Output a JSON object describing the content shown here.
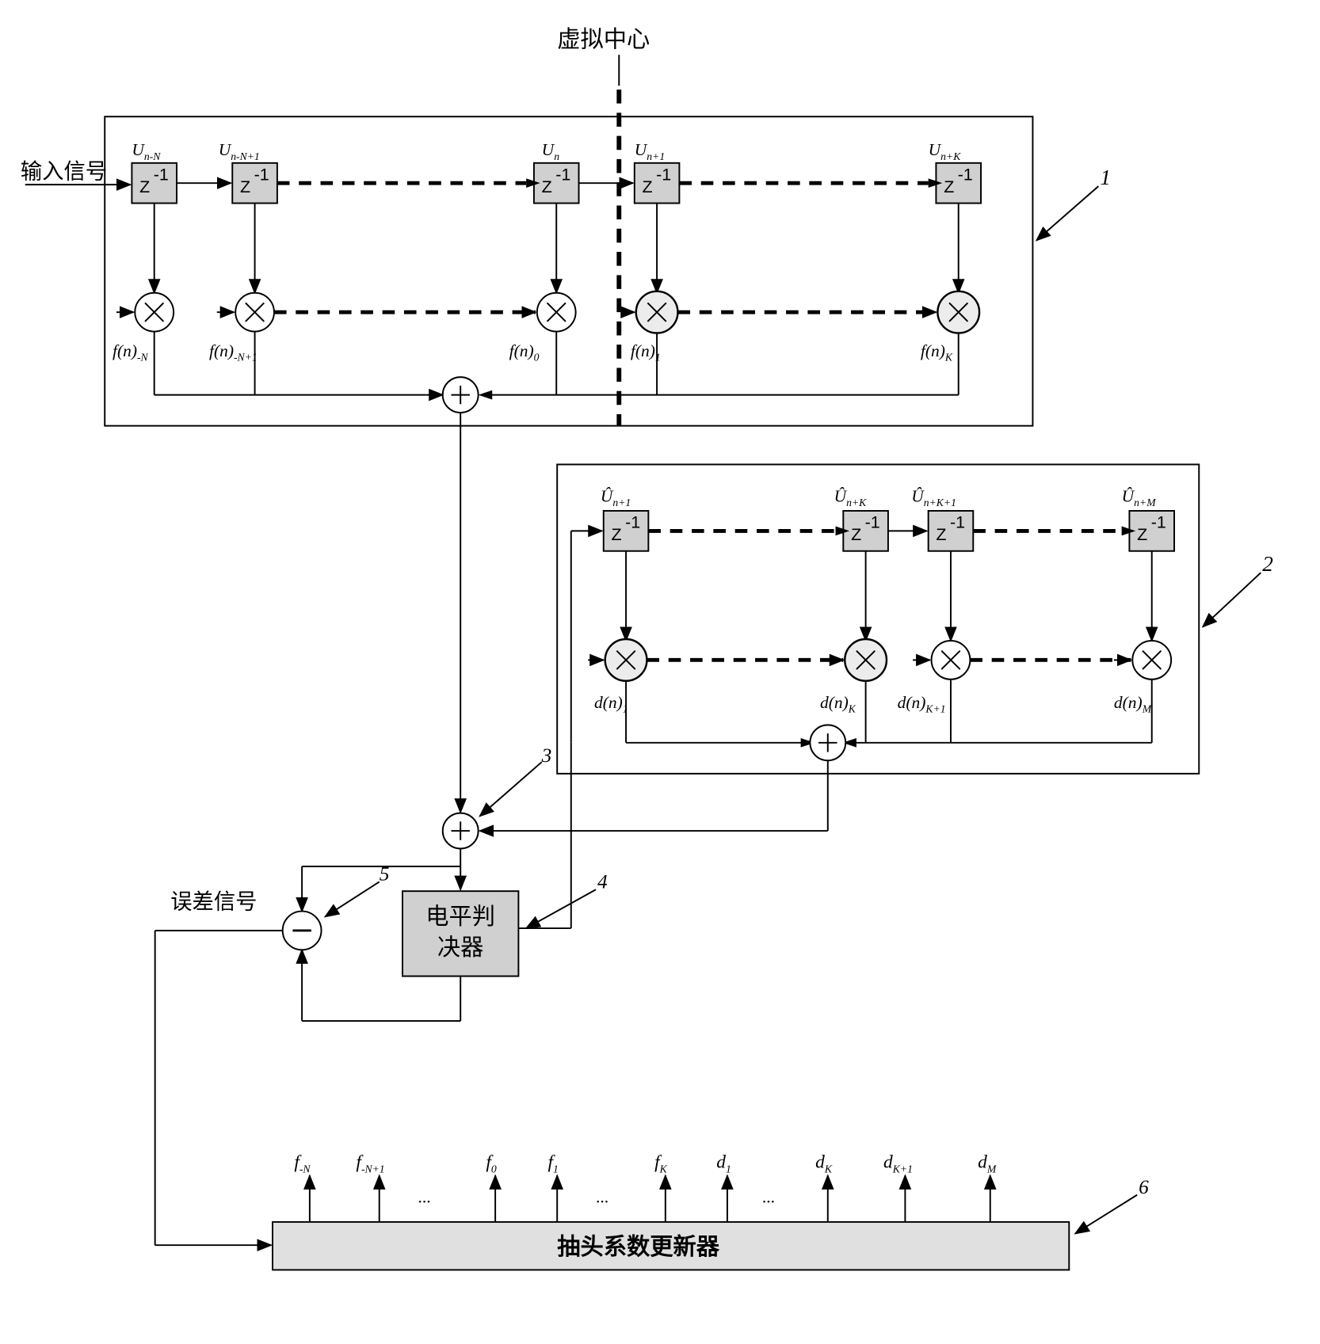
{
  "labels": {
    "virtualCenter": "虚拟中心",
    "inputSignal": "输入信号",
    "errorSignal": "误差信号",
    "levelDecider": "电平判决器",
    "tapUpdater": "抽头系数更新器",
    "zInv": "Z",
    "zExp": "-1"
  },
  "ff": {
    "delayLabels": [
      "U_{n-N}",
      "U_{n-N+1}",
      "U_{n}",
      "U_{n+1}",
      "U_{n+K}"
    ],
    "multLabels": [
      "f(n)_{-N}",
      "f(n)_{-N+1}",
      "f(n)_{0}",
      "f(n)_{1}",
      "f(n)_{K}"
    ],
    "blockRef": "1"
  },
  "fb": {
    "delayLabels": [
      "\\hat U_{n+1}",
      "\\hat U_{n+K}",
      "\\hat U_{n+K+1}",
      "\\hat U_{n+M}"
    ],
    "multLabels": [
      "d(n)_{1}",
      "d(n)_{K}",
      "d(n)_{K+1}",
      "d(n)_{M}"
    ],
    "blockRef": "2"
  },
  "refs": {
    "adder": "3",
    "decider": "4",
    "sub": "5",
    "updater": "6"
  },
  "tapOutputs": [
    "f_{-N}",
    "f_{-N+1}",
    "f_{0}",
    "f_{1}",
    "f_{K}",
    "d_{1}",
    "d_{K}",
    "d_{K+1}",
    "d_{M}"
  ]
}
